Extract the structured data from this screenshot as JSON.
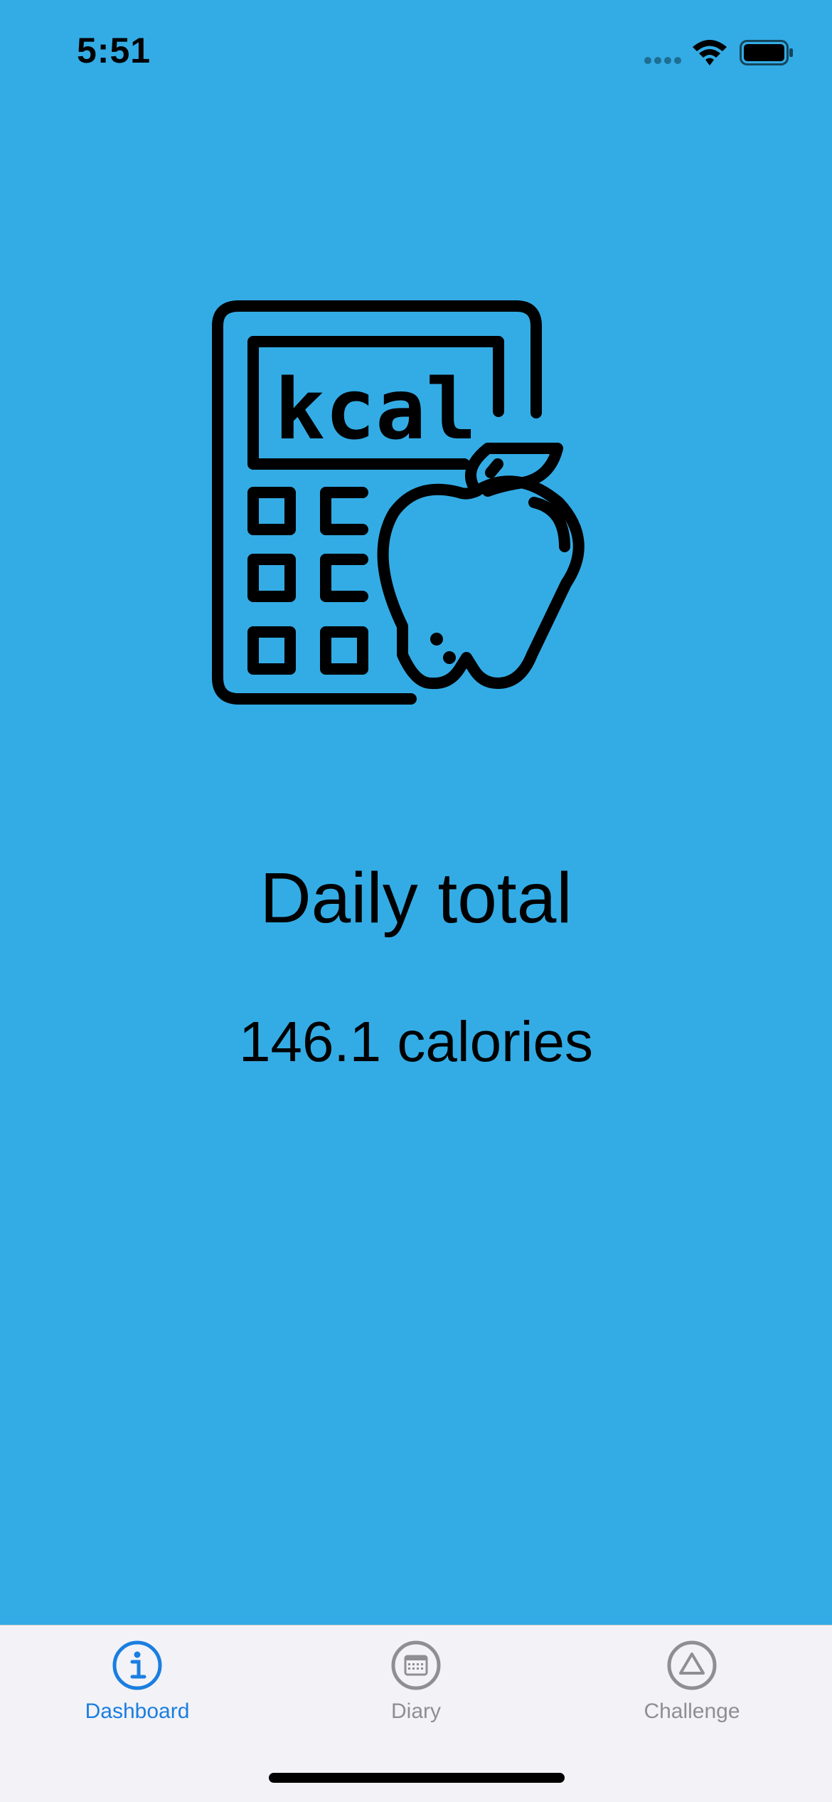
{
  "status_bar": {
    "time": "5:51"
  },
  "main": {
    "icon_name": "calculator-apple-icon",
    "icon_text": "kcal",
    "title": "Daily total",
    "calories": "146.1 calories"
  },
  "tabs": [
    {
      "label": "Dashboard",
      "icon": "info-icon",
      "active": true
    },
    {
      "label": "Diary",
      "icon": "calendar-icon",
      "active": false
    },
    {
      "label": "Challenge",
      "icon": "triangle-icon",
      "active": false
    }
  ],
  "colors": {
    "background": "#33ace5",
    "tab_bar": "#f2f2f7",
    "active_tab": "#1a7ee0",
    "inactive_tab": "#8e8e93"
  }
}
